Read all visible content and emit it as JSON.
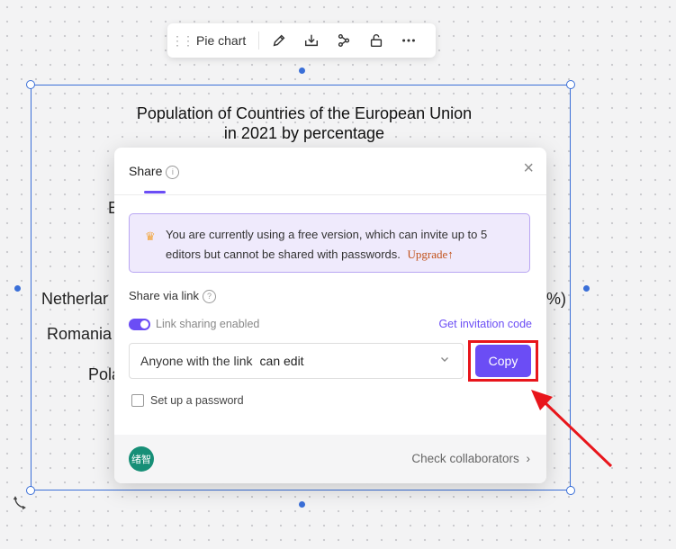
{
  "toolbar": {
    "label": "Pie chart",
    "buttons": [
      "pencil-icon",
      "download-icon",
      "share-nodes-icon",
      "unlock-icon",
      "more-icon"
    ]
  },
  "chart": {
    "title_line1": "Population of Countries of the European Union",
    "title_line2": "in 2021 by percentage",
    "visible_labels": {
      "left_e": "E",
      "netherlands": "Netherlar",
      "romania": "Romania",
      "poland": "Pola",
      "right_pct": "%)"
    }
  },
  "share_dialog": {
    "title": "Share",
    "close_symbol": "×",
    "notice": {
      "text": "You are currently using a free version, which can invite up to 5 editors but cannot be shared with passwords.",
      "upgrade": "Upgrade",
      "upgrade_symbol": "↑"
    },
    "share_via_link": "Share via link",
    "link_sharing_label": "Link sharing enabled",
    "link_sharing_enabled": true,
    "get_invitation_code": "Get invitation code",
    "link_scope": "Anyone with the link",
    "permission": "can edit",
    "copy_button": "Copy",
    "password_label": "Set up a password",
    "password_checked": false,
    "avatar_text": "绪智",
    "check_collaborators": "Check collaborators",
    "check_collaborators_arrow": "›"
  },
  "colors": {
    "accent": "#6b4df5",
    "notice_bg": "#efeafc",
    "highlight": "#e8151b",
    "avatar": "#178f77",
    "selection": "#3a6fd8"
  }
}
